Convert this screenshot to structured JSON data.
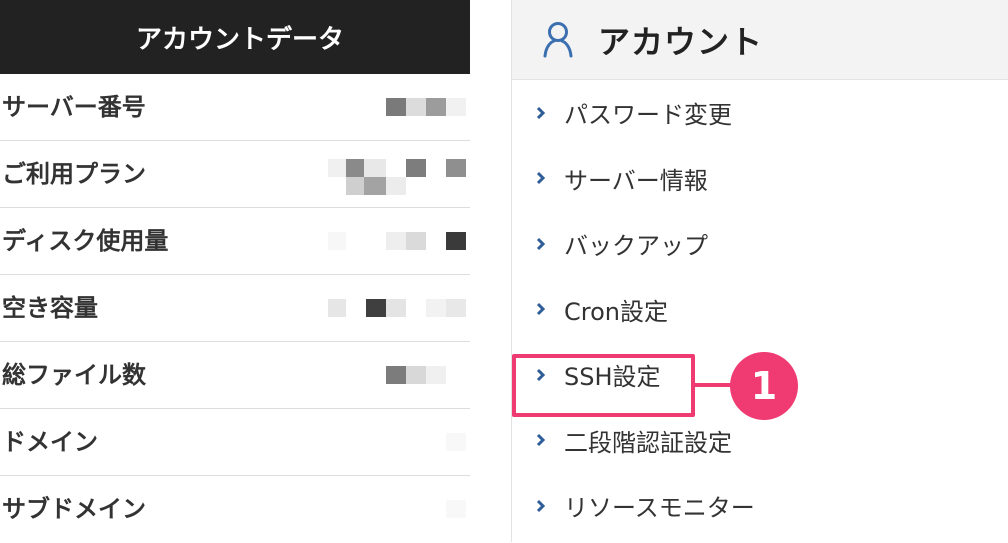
{
  "account_data": {
    "title": "アカウントデータ",
    "rows": [
      {
        "label": "サーバー番号"
      },
      {
        "label": "ご利用プラン"
      },
      {
        "label": "ディスク使用量"
      },
      {
        "label": "空き容量"
      },
      {
        "label": "総ファイル数"
      },
      {
        "label": "ドメイン"
      },
      {
        "label": "サブドメイン"
      }
    ]
  },
  "account_menu": {
    "title": "アカウント",
    "icon": "user-icon",
    "items": [
      {
        "label": "パスワード変更"
      },
      {
        "label": "サーバー情報"
      },
      {
        "label": "バックアップ"
      },
      {
        "label": "Cron設定"
      },
      {
        "label": "SSH設定"
      },
      {
        "label": "二段階認証設定"
      },
      {
        "label": "リソースモニター"
      }
    ]
  },
  "annotation": {
    "step_number": "1",
    "highlighted_item": "SSH設定",
    "color": "#f03a72"
  },
  "colors": {
    "left_header_bg": "#222222",
    "right_header_bg": "#f3f3f3",
    "icon_blue": "#3c6fb0",
    "chevron_blue": "#2f5d97"
  }
}
